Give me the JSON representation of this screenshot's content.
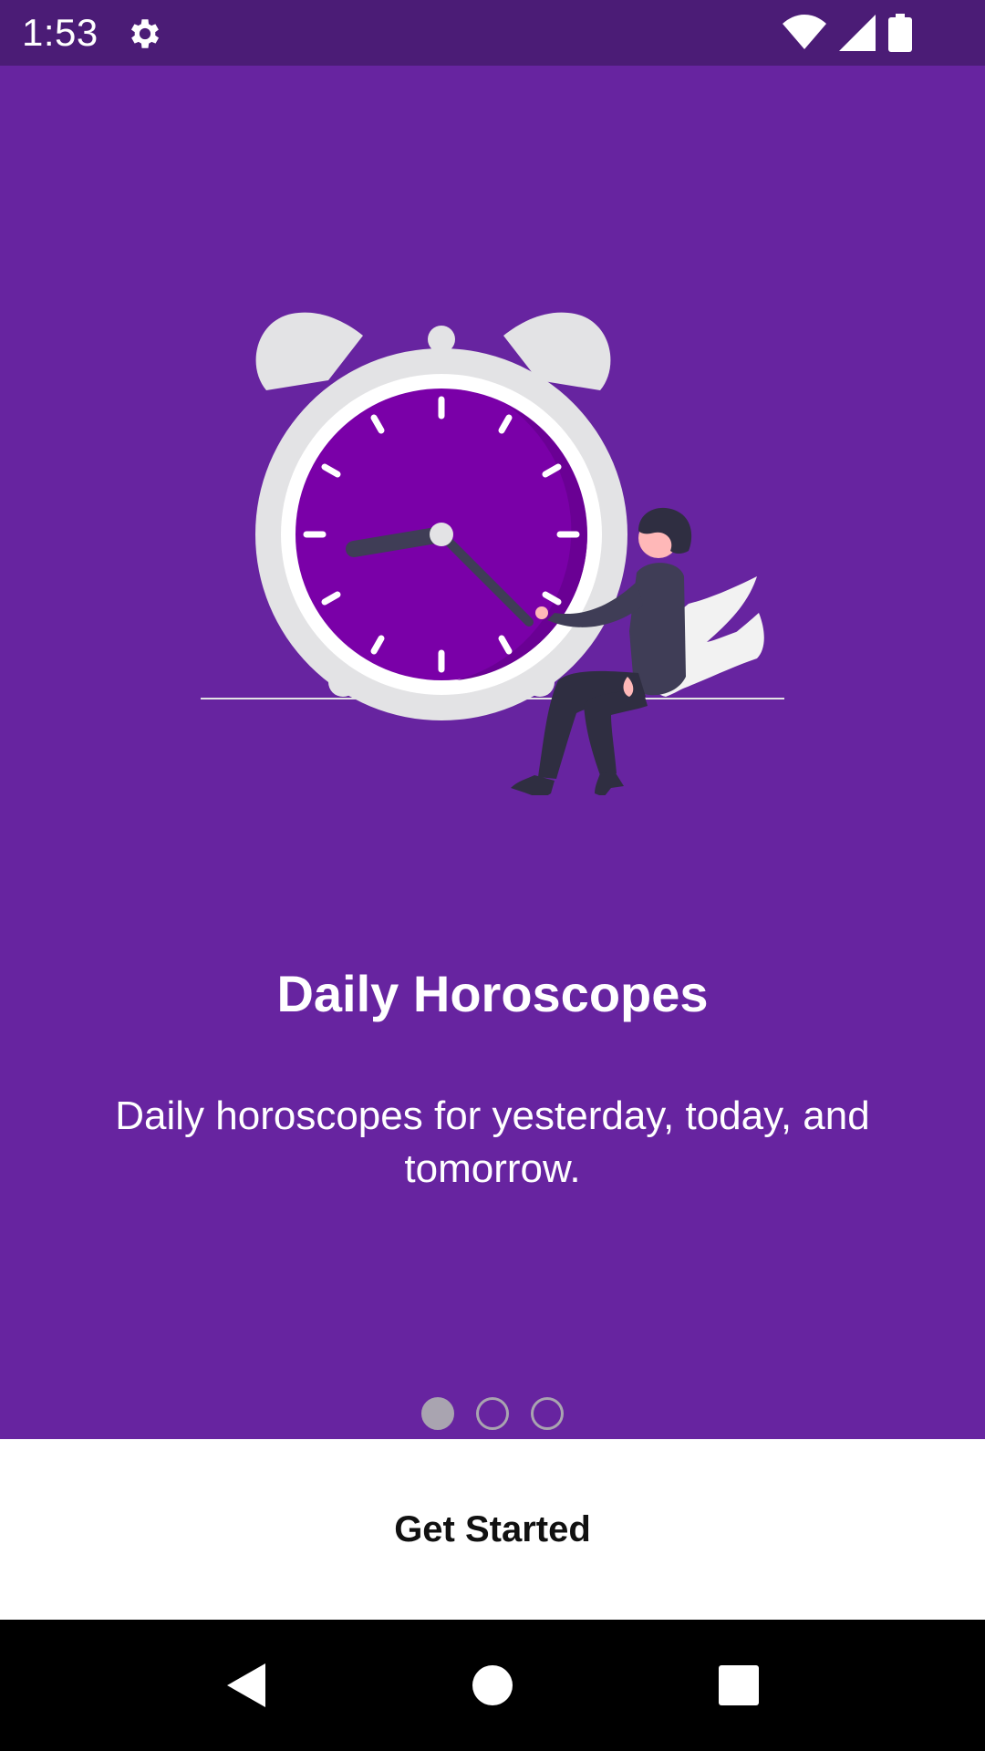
{
  "status_bar": {
    "time": "1:53",
    "icons": [
      "gear-icon",
      "wifi-icon",
      "signal-icon",
      "battery-icon"
    ]
  },
  "slide": {
    "title": "Daily Horoscopes",
    "description": "Daily horoscopes for yesterday, today, and tomorrow.",
    "page_count": 3,
    "active_page": 1
  },
  "actions": {
    "get_started_label": "Get Started"
  },
  "nav": {
    "icons": [
      "back-icon",
      "home-icon",
      "recents-icon"
    ]
  },
  "colors": {
    "background": "#6724a0",
    "status_bar": "#4b1c76",
    "clock_face": "#7a00a8",
    "clock_rim": "#e3e3e5",
    "indicator": "#a9a4b0"
  }
}
